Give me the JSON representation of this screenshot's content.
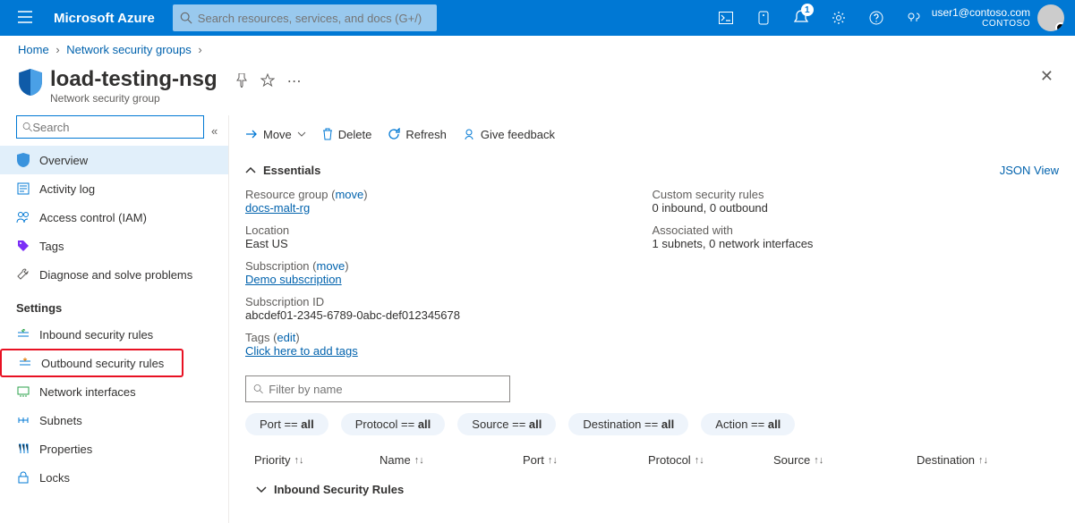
{
  "topbar": {
    "brand": "Microsoft Azure",
    "search_placeholder": "Search resources, services, and docs (G+/)",
    "notification_count": "1",
    "account_email": "user1@contoso.com",
    "account_org": "CONTOSO"
  },
  "breadcrumb": {
    "items": [
      "Home",
      "Network security groups"
    ]
  },
  "header": {
    "title": "load-testing-nsg",
    "subtitle": "Network security group"
  },
  "sidebar": {
    "search_placeholder": "Search",
    "items": [
      {
        "label": "Overview"
      },
      {
        "label": "Activity log"
      },
      {
        "label": "Access control (IAM)"
      },
      {
        "label": "Tags"
      },
      {
        "label": "Diagnose and solve problems"
      }
    ],
    "settings_label": "Settings",
    "settings_items": [
      {
        "label": "Inbound security rules"
      },
      {
        "label": "Outbound security rules"
      },
      {
        "label": "Network interfaces"
      },
      {
        "label": "Subnets"
      },
      {
        "label": "Properties"
      },
      {
        "label": "Locks"
      }
    ]
  },
  "commandbar": {
    "move": "Move",
    "delete": "Delete",
    "refresh": "Refresh",
    "feedback": "Give feedback"
  },
  "essentials": {
    "title": "Essentials",
    "json_view": "JSON View",
    "left": {
      "resource_group_label": "Resource group (",
      "resource_group_move": "move",
      "resource_group_close": ")",
      "resource_group_value": "docs-malt-rg",
      "location_label": "Location",
      "location_value": "East US",
      "subscription_label": "Subscription (",
      "subscription_move": "move",
      "subscription_close": ")",
      "subscription_value": "Demo subscription",
      "subscription_id_label": "Subscription ID",
      "subscription_id_value": "abcdef01-2345-6789-0abc-def012345678",
      "tags_label": "Tags (",
      "tags_edit": "edit",
      "tags_close": ")",
      "tags_value": "Click here to add tags"
    },
    "right": {
      "custom_rules_label": "Custom security rules",
      "custom_rules_value": "0 inbound, 0 outbound",
      "associated_label": "Associated with",
      "associated_value": "1 subnets, 0 network interfaces"
    }
  },
  "filter": {
    "placeholder": "Filter by name",
    "pills": {
      "port": {
        "pre": "Port == ",
        "val": "all"
      },
      "protocol": {
        "pre": "Protocol == ",
        "val": "all"
      },
      "source": {
        "pre": "Source == ",
        "val": "all"
      },
      "destination": {
        "pre": "Destination == ",
        "val": "all"
      },
      "action": {
        "pre": "Action == ",
        "val": "all"
      }
    }
  },
  "table": {
    "cols": {
      "priority": "Priority",
      "name": "Name",
      "port": "Port",
      "protocol": "Protocol",
      "source": "Source",
      "destination": "Destination"
    },
    "group_inbound": "Inbound Security Rules"
  }
}
